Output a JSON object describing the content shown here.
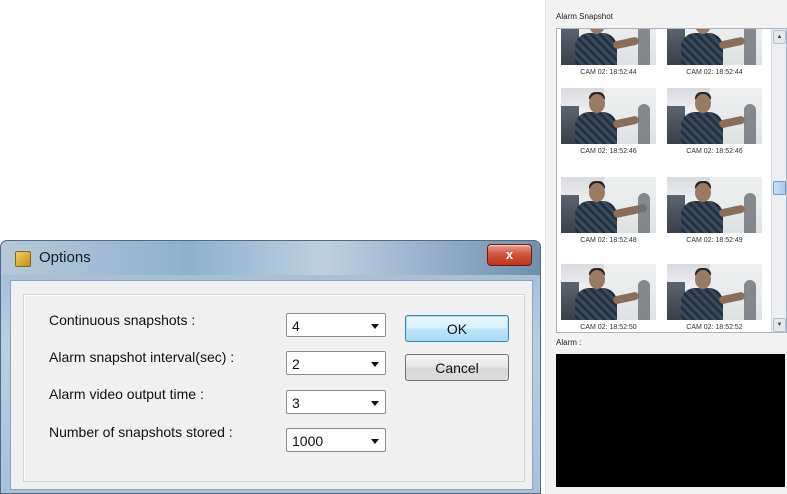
{
  "alarm_panel": {
    "title": "Alarm Snapshot",
    "alarm_label": "Alarm :",
    "snapshots": [
      {
        "caption": "CAM 02: 18:52:44"
      },
      {
        "caption": "CAM 02: 18:52:44"
      },
      {
        "caption": "CAM 02: 18:52:46"
      },
      {
        "caption": "CAM 02: 18:52:46"
      },
      {
        "caption": "CAM 02: 18:52:48"
      },
      {
        "caption": "CAM 02: 18:52:49"
      },
      {
        "caption": "CAM 02: 18:52:50"
      },
      {
        "caption": "CAM 02: 18:52:52"
      }
    ]
  },
  "dialog": {
    "title": "Options",
    "close_label": "x",
    "rows": [
      {
        "label": "Continuous snapshots :",
        "value": "4"
      },
      {
        "label": "Alarm snapshot interval(sec) :",
        "value": "2"
      },
      {
        "label": "Alarm video output time :",
        "value": "3"
      },
      {
        "label": "Number of snapshots stored :",
        "value": "1000"
      }
    ],
    "ok_label": "OK",
    "cancel_label": "Cancel"
  },
  "colors": {
    "accent": "#3c7fb1",
    "close_red": "#c03418",
    "alarm_view_bg": "#000000"
  },
  "icons": {
    "dialog": "options-app-icon",
    "close": "close-icon",
    "combo": "chevron-down-icon",
    "scroll_up": "scroll-up-arrow-icon",
    "scroll_down": "scroll-down-arrow-icon"
  }
}
